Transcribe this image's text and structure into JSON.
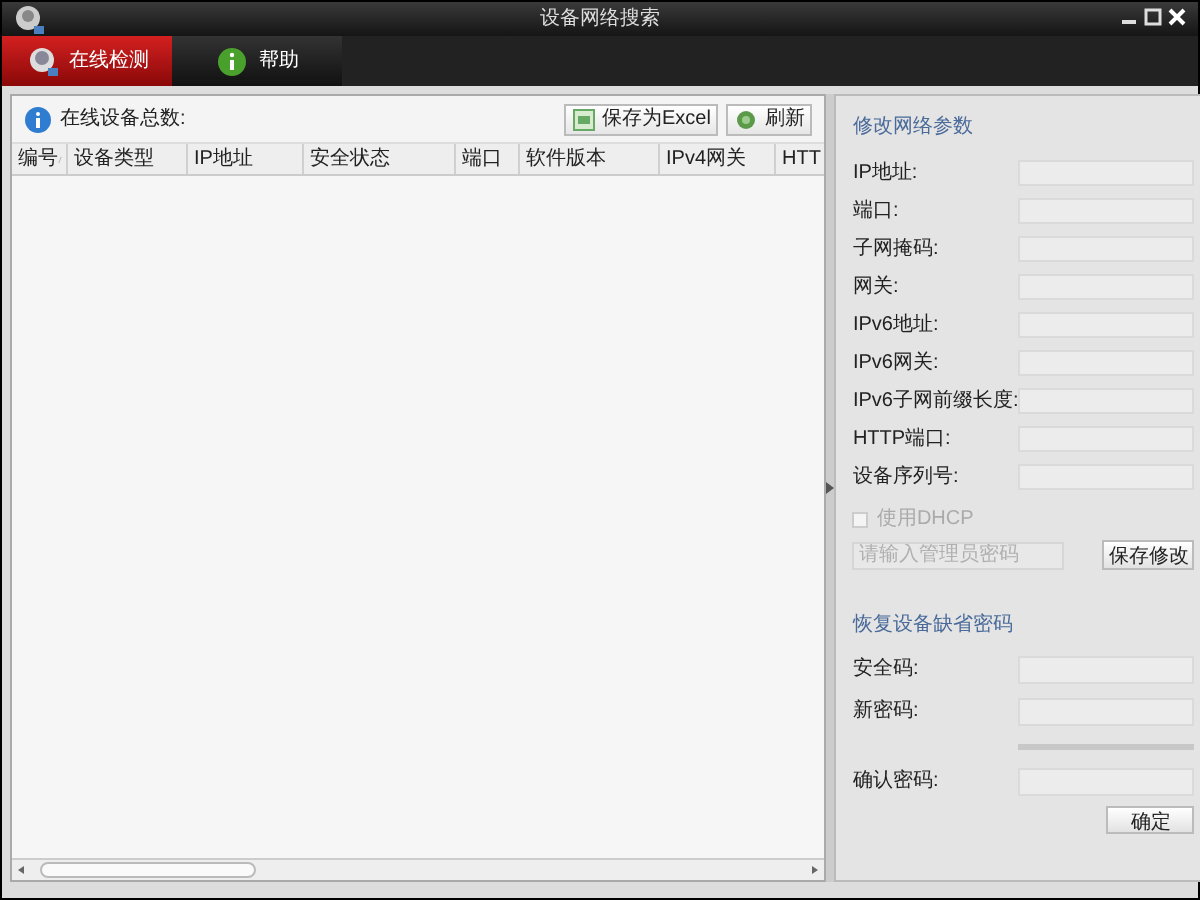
{
  "window": {
    "title": "设备网络搜索"
  },
  "tabs": [
    {
      "label": "在线检测",
      "selected": true,
      "kind": "search"
    },
    {
      "label": "帮助",
      "selected": false,
      "kind": "info"
    }
  ],
  "toolbar": {
    "label": "在线设备总数:",
    "buttons": [
      {
        "label": "保存为Excel",
        "kind": "excel"
      },
      {
        "label": "刷新",
        "kind": "refresh"
      }
    ]
  },
  "table": {
    "columns": [
      {
        "label": "编号",
        "sorted": true
      },
      {
        "label": "设备类型",
        "sorted": false
      },
      {
        "label": "IP地址",
        "sorted": false
      },
      {
        "label": "安全状态",
        "sorted": false
      },
      {
        "label": "端口",
        "sorted": false
      },
      {
        "label": "软件版本",
        "sorted": false
      },
      {
        "label": "IPv4网关",
        "sorted": false
      },
      {
        "label": "HTT",
        "sorted": false
      }
    ]
  },
  "network_params": {
    "title": "修改网络参数",
    "fields": [
      {
        "label": "IP地址:"
      },
      {
        "label": "端口:"
      },
      {
        "label": "子网掩码:"
      },
      {
        "label": "网关:"
      },
      {
        "label": "IPv6地址:"
      },
      {
        "label": "IPv6网关:"
      },
      {
        "label": "IPv6子网前缀长度:"
      },
      {
        "label": "HTTP端口:"
      },
      {
        "label": "设备序列号:"
      }
    ],
    "dhcp": {
      "label": "使用DHCP",
      "checked": false,
      "disabled": true
    },
    "password": {
      "placeholder": "请输入管理员密码"
    },
    "save_button": "保存修改"
  },
  "restore_password": {
    "title": "恢复设备缺省密码",
    "fields": [
      {
        "label": "安全码:",
        "kind": "field"
      },
      {
        "label": "新密码:",
        "kind": "field"
      },
      {
        "kind": "strength"
      },
      {
        "label": "确认密码:",
        "kind": "field"
      }
    ],
    "confirm_button": "确定"
  }
}
